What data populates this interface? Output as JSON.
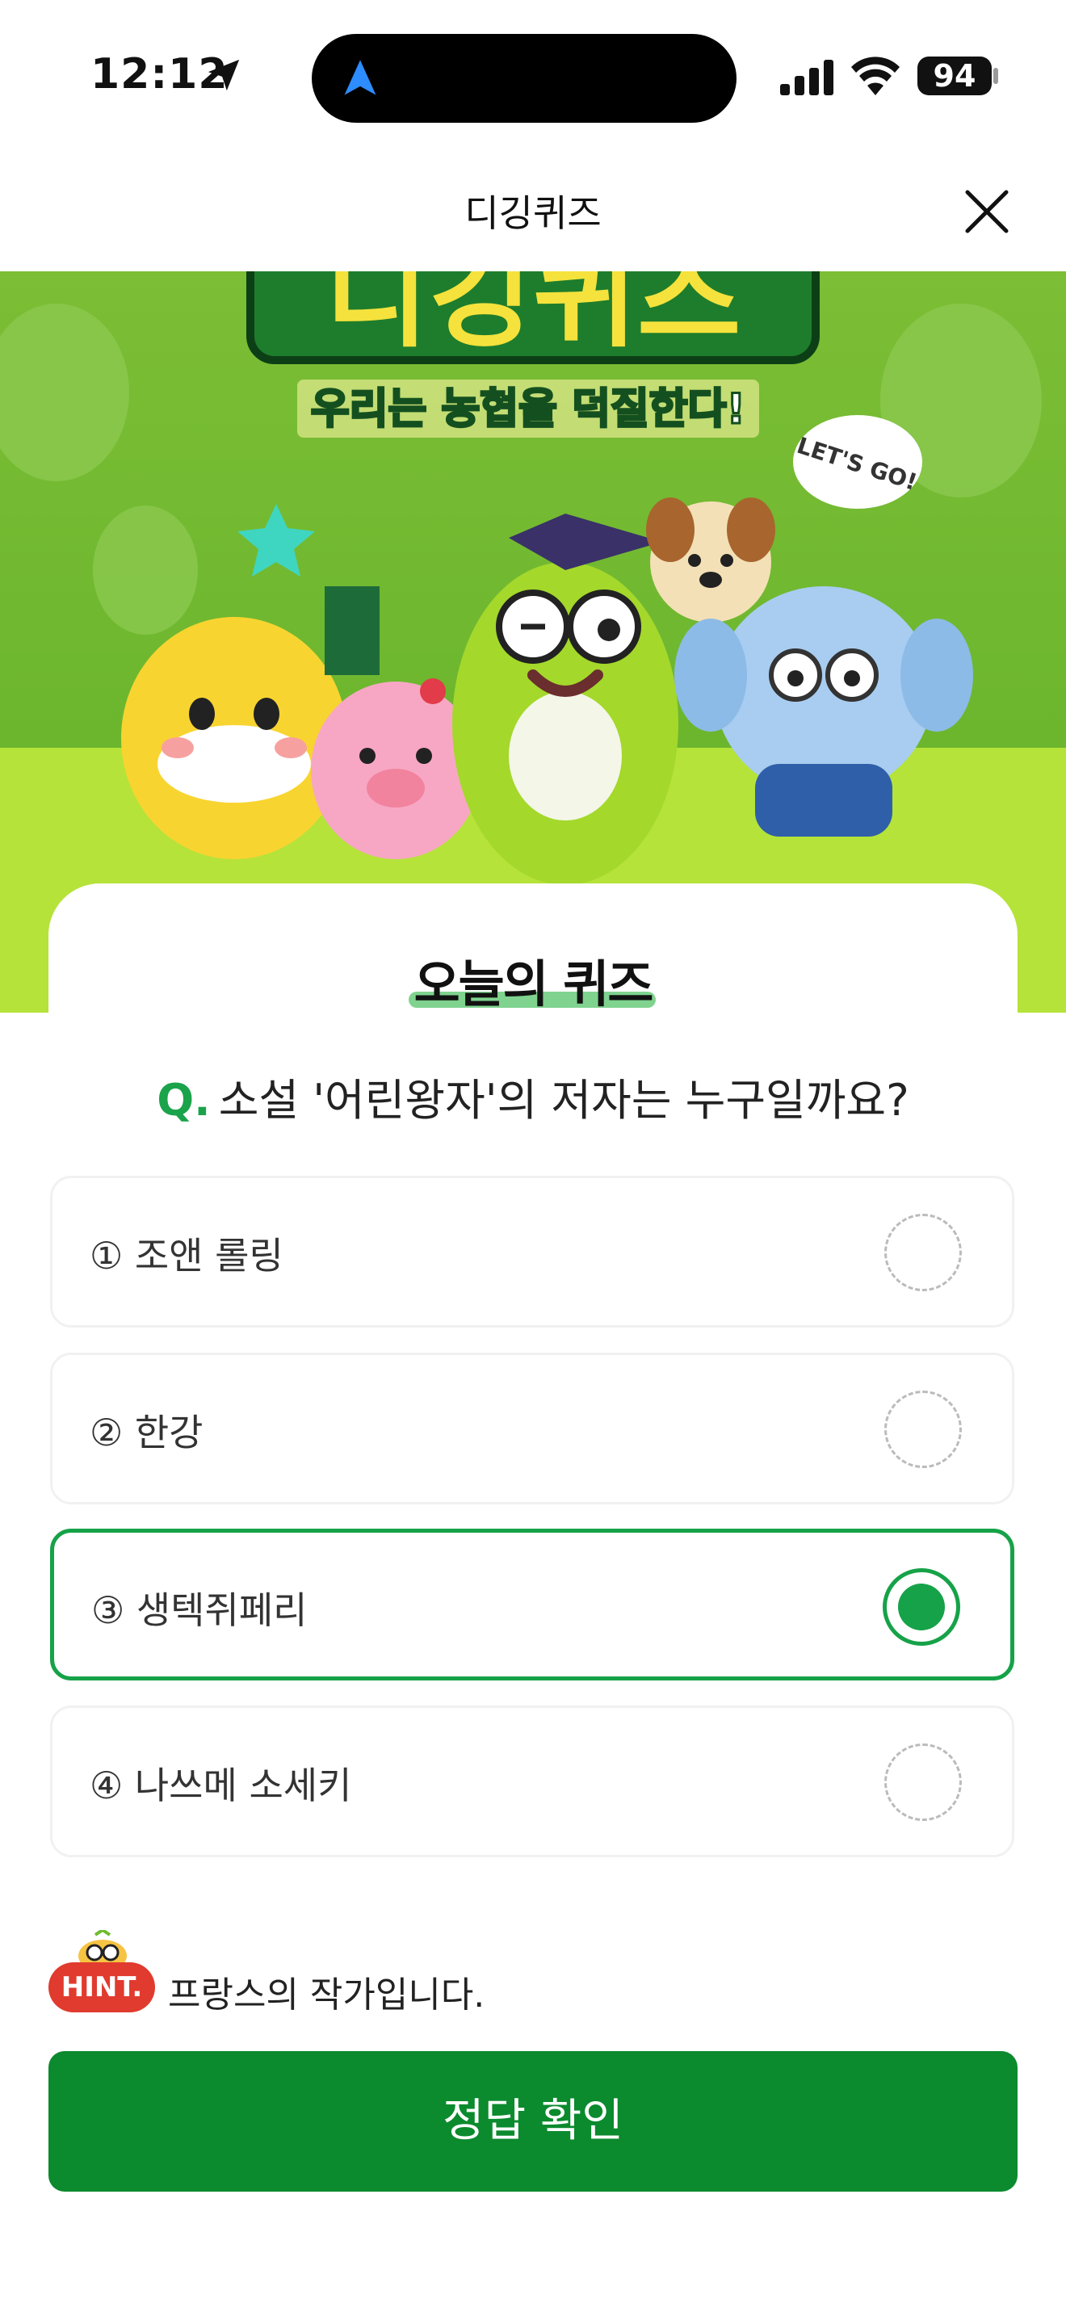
{
  "status_bar": {
    "time": "12:12",
    "battery": "94"
  },
  "header": {
    "title": "디깅퀴즈"
  },
  "banner": {
    "headline": "디깅퀴즈",
    "slogan": "우리는 농협을 덕질한다!",
    "speech": "LET'S GO!"
  },
  "quiz": {
    "section_title": "오늘의 퀴즈",
    "question_prefix": "Q.",
    "question": "소설 '어린왕자'의 저자는 누구일까요?",
    "options": [
      {
        "label": "① 조앤 롤링",
        "selected": false
      },
      {
        "label": "② 한강",
        "selected": false
      },
      {
        "label": "③ 생텍쥐페리",
        "selected": true
      },
      {
        "label": "④ 나쓰메 소세키",
        "selected": false
      }
    ]
  },
  "hint": {
    "badge": "HINT.",
    "text": "프랑스의 작가입니다."
  },
  "submit": {
    "label": "정답 확인"
  },
  "colors": {
    "accent": "#16a248",
    "button": "#0b8a2e",
    "banner_green": "#86c43a",
    "hint_red": "#e03b2e"
  }
}
